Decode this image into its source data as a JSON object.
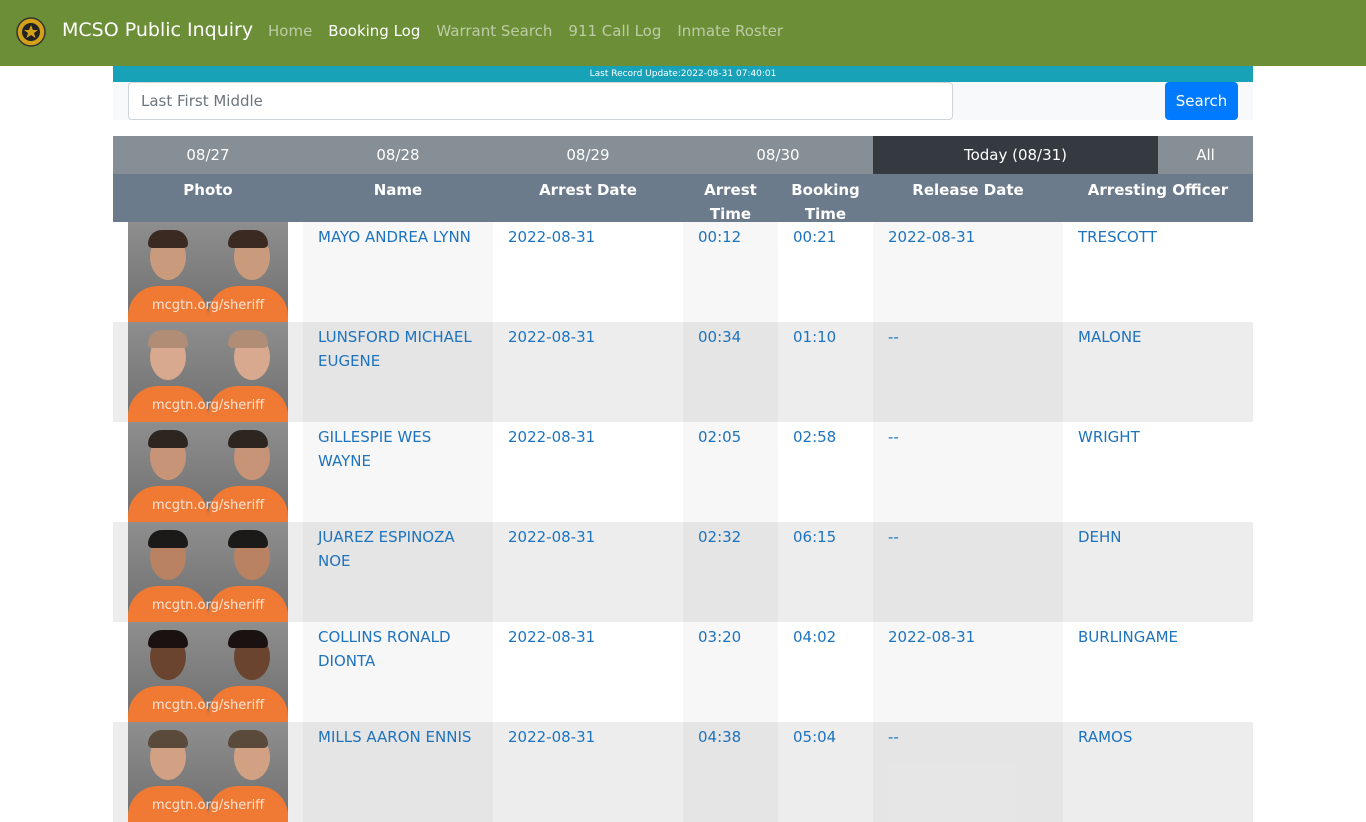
{
  "navbar": {
    "brand": "MCSO Public Inquiry",
    "links": [
      "Home",
      "Booking Log",
      "Warrant Search",
      "911 Call Log",
      "Inmate Roster"
    ],
    "active_link": "Booking Log"
  },
  "update_bar": {
    "text": "Last Record Update:2022-08-31 07:40:01"
  },
  "search": {
    "placeholder": "Last First Middle",
    "button": "Search"
  },
  "tabs": [
    "08/27",
    "08/28",
    "08/29",
    "08/30",
    "Today (08/31)",
    "All"
  ],
  "active_tab": "Today (08/31)",
  "table": {
    "headers": [
      "Photo",
      "Name",
      "Arrest Date",
      "Arrest Time",
      "Booking Time",
      "Release Date",
      "Arresting Officer"
    ],
    "photo_watermark": "mcgtn.org/sheriff",
    "rows": [
      {
        "name": "MAYO ANDREA LYNN",
        "arrest_date": "2022-08-31",
        "arrest_time": "00:12",
        "booking_time": "00:21",
        "release_date": "2022-08-31",
        "officer": "TRESCOTT"
      },
      {
        "name": "LUNSFORD MICHAEL EUGENE",
        "arrest_date": "2022-08-31",
        "arrest_time": "00:34",
        "booking_time": "01:10",
        "release_date": "--",
        "officer": "MALONE"
      },
      {
        "name": "GILLESPIE WES WAYNE",
        "arrest_date": "2022-08-31",
        "arrest_time": "02:05",
        "booking_time": "02:58",
        "release_date": "--",
        "officer": "WRIGHT"
      },
      {
        "name": "JUAREZ ESPINOZA NOE",
        "arrest_date": "2022-08-31",
        "arrest_time": "02:32",
        "booking_time": "06:15",
        "release_date": "--",
        "officer": "DEHN"
      },
      {
        "name": "COLLINS RONALD DIONTA",
        "arrest_date": "2022-08-31",
        "arrest_time": "03:20",
        "booking_time": "04:02",
        "release_date": "2022-08-31",
        "officer": "BURLINGAME"
      },
      {
        "name": "MILLS AARON ENNIS",
        "arrest_date": "2022-08-31",
        "arrest_time": "04:38",
        "booking_time": "05:04",
        "release_date": "--",
        "officer": "RAMOS"
      }
    ]
  },
  "colors": {
    "navbar": "#6b8e37",
    "update_bar": "#17a2b8",
    "tab_bar": "#868e96",
    "tab_active": "#343a40",
    "table_header": "#6c7b8b",
    "link": "#1e73be",
    "search_button": "#007bff",
    "shirt": "#f07a33"
  }
}
